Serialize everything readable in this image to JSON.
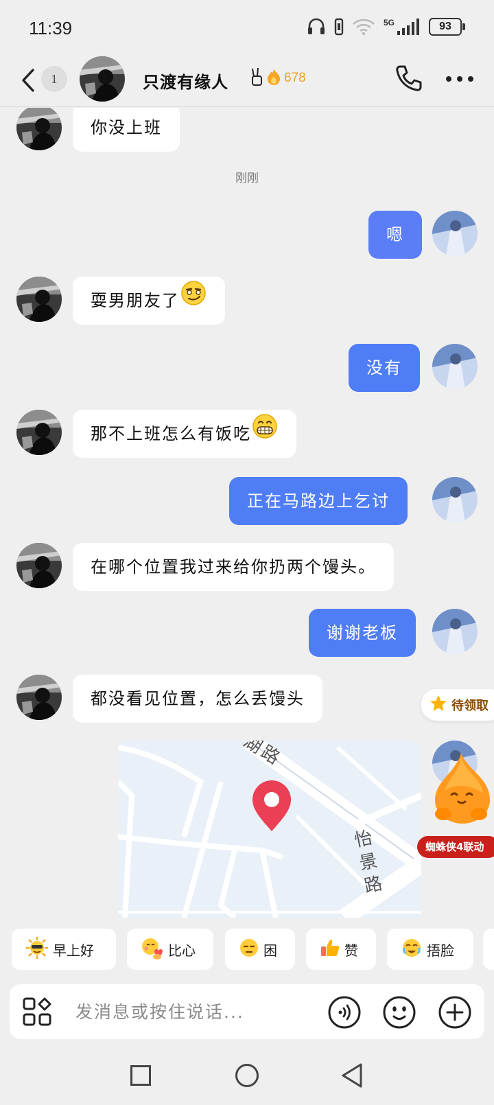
{
  "status_bar": {
    "time": "11:39",
    "network": "5G",
    "battery": "93",
    "icons": [
      "headphones-icon",
      "wifi-icon",
      "signal-icon",
      "battery-icon"
    ]
  },
  "header": {
    "unread_count": "1",
    "contact_name": "只渡有缘人",
    "streak_count": "678",
    "icons": [
      "back-arrow-icon",
      "fire-icon",
      "phone-icon",
      "more-icon"
    ]
  },
  "messages": [
    {
      "side": "in",
      "text": "你没上班"
    },
    {
      "type": "time",
      "text": "刚刚"
    },
    {
      "side": "out",
      "text": "嗯"
    },
    {
      "side": "in",
      "text": "耍男朋友了",
      "emoji": "smirk-emoji"
    },
    {
      "side": "out",
      "text": "没有"
    },
    {
      "side": "in",
      "text": "那不上班怎么有饭吃",
      "emoji": "grin-emoji"
    },
    {
      "side": "out",
      "text": "正在马路边上乞讨"
    },
    {
      "side": "in",
      "text": "在哪个位置我过来给你扔两个馒头。"
    },
    {
      "side": "out",
      "text": "谢谢老板"
    },
    {
      "side": "in",
      "text": "都没看见位置，怎么丢馒头"
    },
    {
      "side": "out",
      "type": "location",
      "map_labels": [
        "湖路",
        "怡景路"
      ]
    }
  ],
  "widget": {
    "task_label": "待领取",
    "promo_text": "蜘蛛侠4联动"
  },
  "quick_replies": [
    {
      "label": "早上好",
      "icon": "sun-emoji"
    },
    {
      "label": "比心",
      "icon": "heart-hands-emoji"
    },
    {
      "label": "困",
      "icon": "sleepy-emoji"
    },
    {
      "label": "赞",
      "icon": "thumbs-up-emoji"
    },
    {
      "label": "捂脸",
      "icon": "facepalm-emoji"
    }
  ],
  "input": {
    "placeholder": "发消息或按住说话..."
  },
  "colors": {
    "outgoing_bubble": "#4f7df5",
    "incoming_bubble": "#ffffff",
    "background": "#efefef",
    "streak": "#f0a020",
    "promo": "#c9201c"
  }
}
